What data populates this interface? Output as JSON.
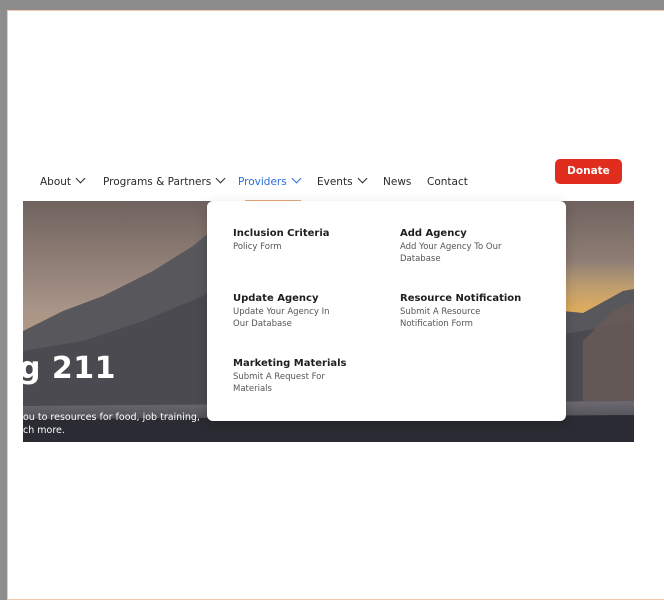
{
  "nav": {
    "items": [
      {
        "label": "About",
        "has_caret": true
      },
      {
        "label": "Programs & Partners",
        "has_caret": true
      },
      {
        "label": "Providers",
        "has_caret": true,
        "active": true
      },
      {
        "label": "Events",
        "has_caret": true
      },
      {
        "label": "News",
        "has_caret": false
      },
      {
        "label": "Contact",
        "has_caret": false
      }
    ],
    "donate_label": "Donate"
  },
  "hero": {
    "title": "g 211",
    "subtitle_line1": "ou to resources for food, job training,",
    "subtitle_line2": "ch more."
  },
  "dropdown": {
    "items": [
      {
        "title": "Inclusion Criteria",
        "desc": "Policy Form"
      },
      {
        "title": "Add Agency",
        "desc": "Add Your Agency To Our Database"
      },
      {
        "title": "Update Agency",
        "desc": "Update Your Agency In Our Database"
      },
      {
        "title": "Resource Notification",
        "desc": "Submit A Resource Notification Form"
      },
      {
        "title": "Marketing Materials",
        "desc": "Submit A Request For Materials"
      }
    ]
  },
  "colors": {
    "accent": "#2a6fdb",
    "donate": "#e12d1d",
    "underline": "#e8a87c"
  }
}
